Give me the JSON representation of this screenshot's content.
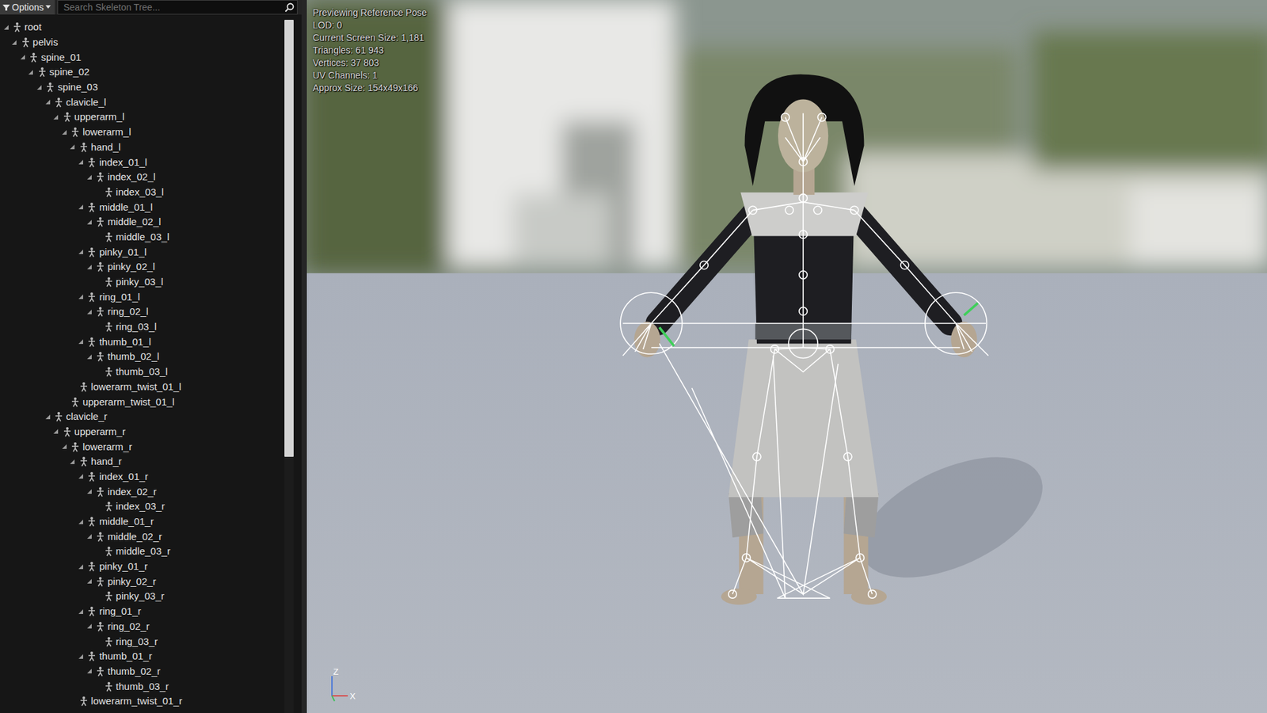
{
  "toolbar": {
    "options_label": "Options",
    "search_placeholder": "Search Skeleton Tree..."
  },
  "scrollbar": {
    "level": 0.63
  },
  "skeleton_tree": [
    {
      "name": "root",
      "depth": 0,
      "expanded": true
    },
    {
      "name": "pelvis",
      "depth": 1,
      "expanded": true
    },
    {
      "name": "spine_01",
      "depth": 2,
      "expanded": true
    },
    {
      "name": "spine_02",
      "depth": 3,
      "expanded": true
    },
    {
      "name": "spine_03",
      "depth": 4,
      "expanded": true
    },
    {
      "name": "clavicle_l",
      "depth": 5,
      "expanded": true
    },
    {
      "name": "upperarm_l",
      "depth": 6,
      "expanded": true
    },
    {
      "name": "lowerarm_l",
      "depth": 7,
      "expanded": true
    },
    {
      "name": "hand_l",
      "depth": 8,
      "expanded": true
    },
    {
      "name": "index_01_l",
      "depth": 9,
      "expanded": true
    },
    {
      "name": "index_02_l",
      "depth": 10,
      "expanded": true
    },
    {
      "name": "index_03_l",
      "depth": 11,
      "expanded": false
    },
    {
      "name": "middle_01_l",
      "depth": 9,
      "expanded": true
    },
    {
      "name": "middle_02_l",
      "depth": 10,
      "expanded": true
    },
    {
      "name": "middle_03_l",
      "depth": 11,
      "expanded": false
    },
    {
      "name": "pinky_01_l",
      "depth": 9,
      "expanded": true
    },
    {
      "name": "pinky_02_l",
      "depth": 10,
      "expanded": true
    },
    {
      "name": "pinky_03_l",
      "depth": 11,
      "expanded": false
    },
    {
      "name": "ring_01_l",
      "depth": 9,
      "expanded": true
    },
    {
      "name": "ring_02_l",
      "depth": 10,
      "expanded": true
    },
    {
      "name": "ring_03_l",
      "depth": 11,
      "expanded": false
    },
    {
      "name": "thumb_01_l",
      "depth": 9,
      "expanded": true
    },
    {
      "name": "thumb_02_l",
      "depth": 10,
      "expanded": true
    },
    {
      "name": "thumb_03_l",
      "depth": 11,
      "expanded": false
    },
    {
      "name": "lowerarm_twist_01_l",
      "depth": 8,
      "expanded": false
    },
    {
      "name": "upperarm_twist_01_l",
      "depth": 7,
      "expanded": false
    },
    {
      "name": "clavicle_r",
      "depth": 5,
      "expanded": true
    },
    {
      "name": "upperarm_r",
      "depth": 6,
      "expanded": true
    },
    {
      "name": "lowerarm_r",
      "depth": 7,
      "expanded": true
    },
    {
      "name": "hand_r",
      "depth": 8,
      "expanded": true
    },
    {
      "name": "index_01_r",
      "depth": 9,
      "expanded": true
    },
    {
      "name": "index_02_r",
      "depth": 10,
      "expanded": true
    },
    {
      "name": "index_03_r",
      "depth": 11,
      "expanded": false
    },
    {
      "name": "middle_01_r",
      "depth": 9,
      "expanded": true
    },
    {
      "name": "middle_02_r",
      "depth": 10,
      "expanded": true
    },
    {
      "name": "middle_03_r",
      "depth": 11,
      "expanded": false
    },
    {
      "name": "pinky_01_r",
      "depth": 9,
      "expanded": true
    },
    {
      "name": "pinky_02_r",
      "depth": 10,
      "expanded": true
    },
    {
      "name": "pinky_03_r",
      "depth": 11,
      "expanded": false
    },
    {
      "name": "ring_01_r",
      "depth": 9,
      "expanded": true
    },
    {
      "name": "ring_02_r",
      "depth": 10,
      "expanded": true
    },
    {
      "name": "ring_03_r",
      "depth": 11,
      "expanded": false
    },
    {
      "name": "thumb_01_r",
      "depth": 9,
      "expanded": true
    },
    {
      "name": "thumb_02_r",
      "depth": 10,
      "expanded": true
    },
    {
      "name": "thumb_03_r",
      "depth": 11,
      "expanded": false
    },
    {
      "name": "lowerarm_twist_01_r",
      "depth": 8,
      "expanded": false
    }
  ],
  "viewport": {
    "info": [
      "Previewing Reference Pose",
      "LOD: 0",
      "Current Screen Size: 1,181",
      "Triangles: 61 943",
      "Vertices: 37 803",
      "UV Channels: 1",
      "Approx Size: 154x49x166"
    ],
    "axes": [
      "Z",
      "X"
    ]
  }
}
